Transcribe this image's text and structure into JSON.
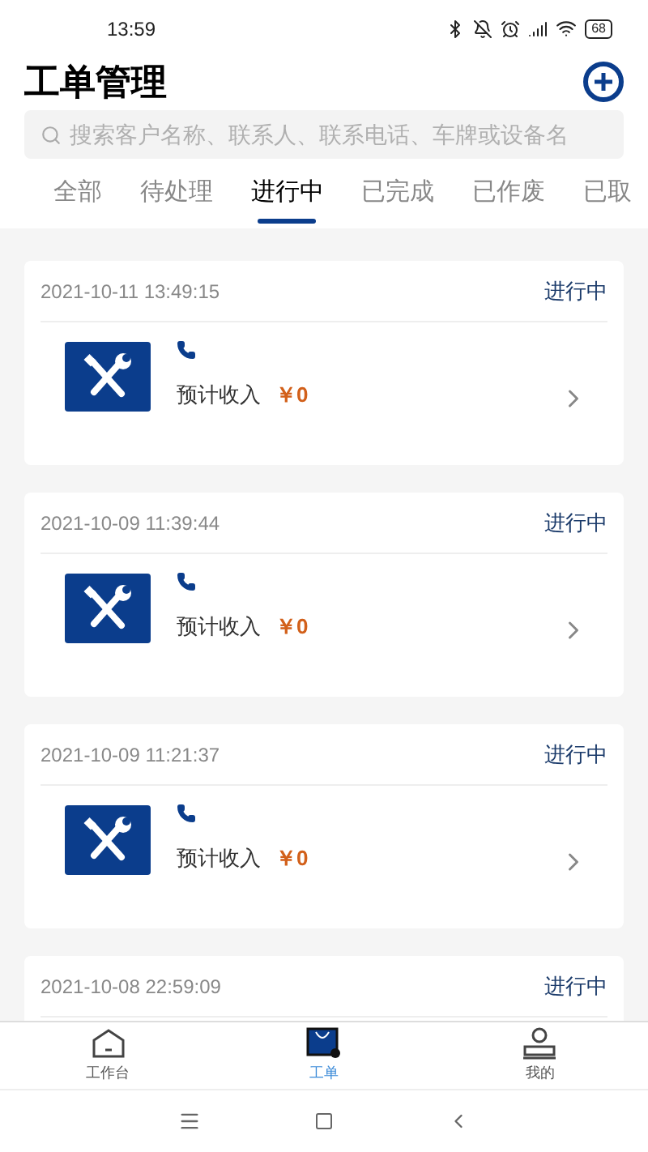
{
  "status_bar": {
    "time": "13:59",
    "battery": "68"
  },
  "header": {
    "title": "工单管理"
  },
  "search": {
    "placeholder": "搜索客户名称、联系人、联系电话、车牌或设备名"
  },
  "tabs": [
    {
      "label": "全部",
      "selected": false
    },
    {
      "label": "待处理",
      "selected": false
    },
    {
      "label": "进行中",
      "selected": true
    },
    {
      "label": "已完成",
      "selected": false
    },
    {
      "label": "已作废",
      "selected": false
    },
    {
      "label": "已取",
      "selected": false
    }
  ],
  "orders": [
    {
      "time": "2021-10-11 13:49:15",
      "status": "进行中",
      "income_label": "预计收入",
      "income": "￥0"
    },
    {
      "time": "2021-10-09 11:39:44",
      "status": "进行中",
      "income_label": "预计收入",
      "income": "￥0"
    },
    {
      "time": "2021-10-09 11:21:37",
      "status": "进行中",
      "income_label": "预计收入",
      "income": "￥0"
    },
    {
      "time": "2021-10-08 22:59:09",
      "status": "进行中"
    }
  ],
  "bottom_nav": [
    {
      "label": "工作台",
      "kind": "home",
      "selected": false
    },
    {
      "label": "工单",
      "kind": "orders",
      "selected": true
    },
    {
      "label": "我的",
      "kind": "user",
      "selected": false
    }
  ]
}
